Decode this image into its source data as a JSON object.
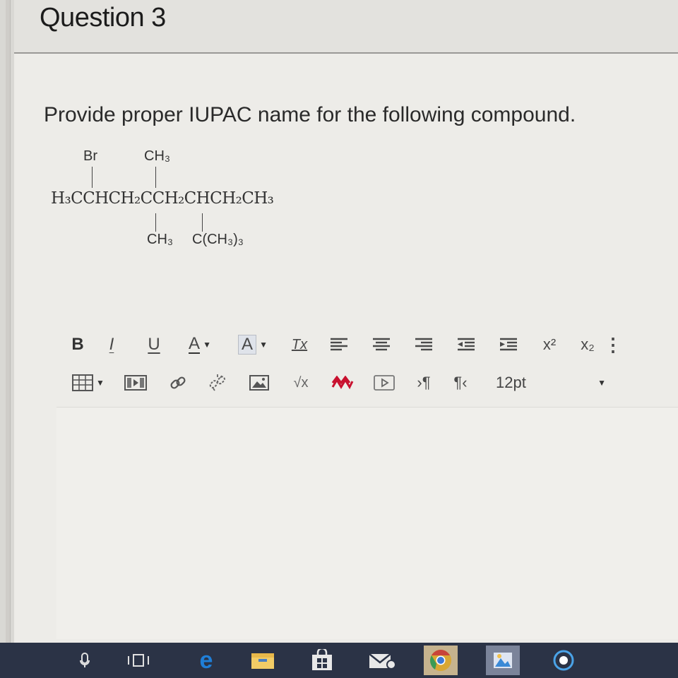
{
  "header": {
    "title": "Question 3"
  },
  "question": {
    "prompt": "Provide proper IUPAC name for the following compound.",
    "compound": {
      "main_chain": "H₃CCHCH₂CCH₂CHCH₂CH₃",
      "top_left_substituent": "Br",
      "top_right_substituent": "CH₃",
      "bottom_left_substituent": "CH₃",
      "bottom_right_substituent": "C(CH₃)₃"
    }
  },
  "toolbar": {
    "row1": [
      {
        "id": "bold",
        "label": "B",
        "icon": "bold-icon"
      },
      {
        "id": "italic",
        "label": "I",
        "icon": "italic-icon"
      },
      {
        "id": "underline",
        "label": "U",
        "icon": "underline-icon"
      },
      {
        "id": "font-color",
        "label": "A",
        "icon": "font-color-icon"
      },
      {
        "id": "highlight",
        "label": "A",
        "icon": "highlight-color-icon"
      },
      {
        "id": "clear-format",
        "label": "Tx",
        "icon": "clear-formatting-icon"
      },
      {
        "id": "align-left",
        "icon": "align-left-icon"
      },
      {
        "id": "align-center",
        "icon": "align-center-icon"
      },
      {
        "id": "align-right",
        "icon": "align-right-icon"
      },
      {
        "id": "outdent",
        "icon": "outdent-icon"
      },
      {
        "id": "indent",
        "icon": "indent-icon"
      },
      {
        "id": "superscript",
        "label": "x²",
        "icon": "superscript-icon"
      },
      {
        "id": "subscript",
        "label": "x₂",
        "icon": "subscript-icon"
      }
    ],
    "row2": [
      {
        "id": "table",
        "icon": "table-icon"
      },
      {
        "id": "media",
        "icon": "media-icon"
      },
      {
        "id": "link",
        "icon": "link-icon"
      },
      {
        "id": "unlink",
        "icon": "unlink-icon"
      },
      {
        "id": "image",
        "icon": "image-icon"
      },
      {
        "id": "equation",
        "label": "√x",
        "icon": "square-root-icon"
      },
      {
        "id": "chemistry",
        "icon": "chemistry-icon"
      },
      {
        "id": "embed",
        "icon": "embed-media-icon"
      },
      {
        "id": "ltr",
        "icon": "ltr-paragraph-icon"
      },
      {
        "id": "rtl",
        "icon": "rtl-paragraph-icon"
      }
    ],
    "font_size": "12pt"
  },
  "editor": {
    "value": ""
  },
  "taskbar": {
    "items": [
      "cortana-mic-icon",
      "task-view-icon",
      "edge-browser-icon",
      "file-explorer-icon",
      "store-icon",
      "mail-icon",
      "chrome-icon",
      "photos-icon",
      "app-icon"
    ]
  },
  "colors": {
    "page_bg": "#edece8",
    "header_border": "#9a9996",
    "taskbar_bg": "#2b3346",
    "accent_red": "#c8102e",
    "edge_blue": "#1f7fd8"
  }
}
